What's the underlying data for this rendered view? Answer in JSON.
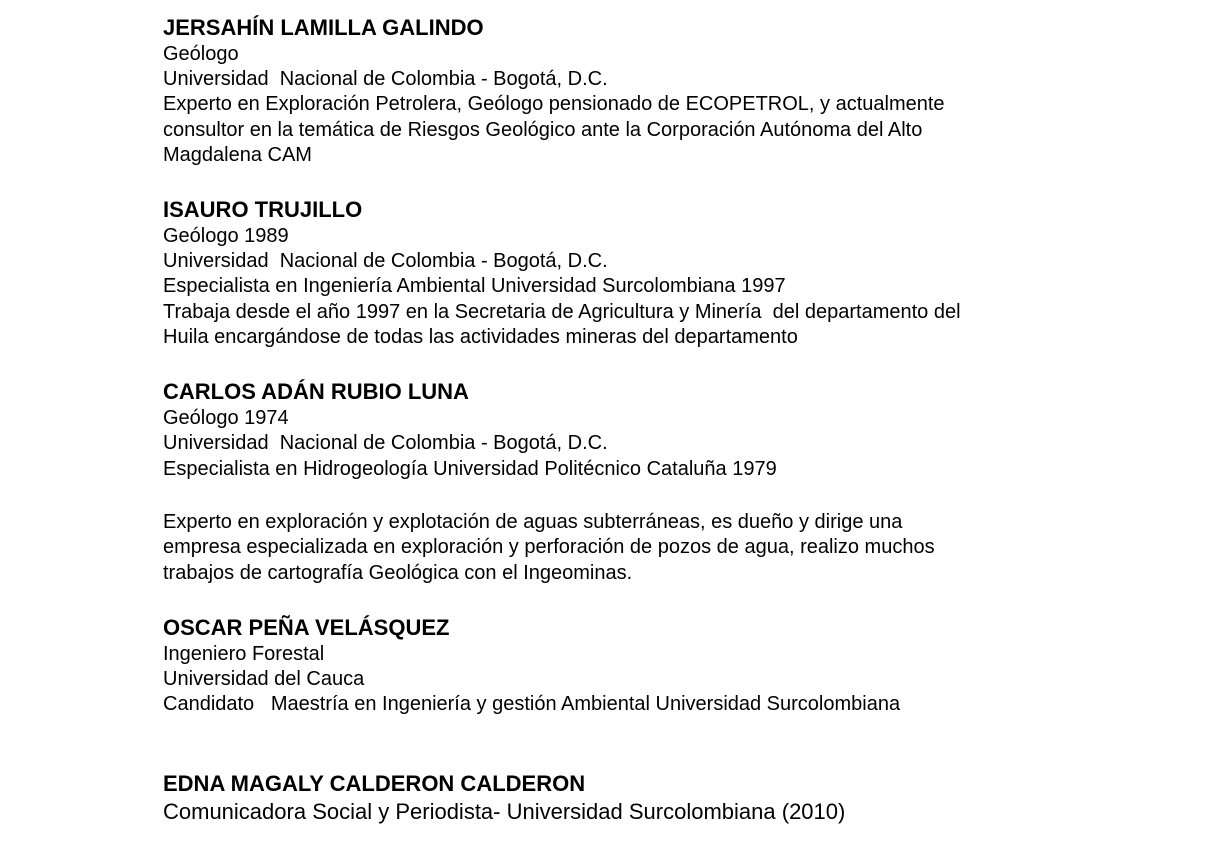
{
  "people": [
    {
      "name": "JERSAHÍN LAMILLA GALINDO",
      "lines": [
        "Geólogo",
        "Universidad  Nacional de Colombia - Bogotá, D.C.",
        "Experto en Exploración Petrolera, Geólogo pensionado de ECOPETROL, y actualmente",
        "consultor en la temática de Riesgos Geológico ante la Corporación Autónoma del Alto",
        "Magdalena CAM"
      ]
    },
    {
      "name": "ISAURO TRUJILLO",
      "lines": [
        "Geólogo 1989",
        "Universidad  Nacional de Colombia - Bogotá, D.C.",
        "Especialista en Ingeniería Ambiental Universidad Surcolombiana 1997",
        "Trabaja desde el año 1997 en la Secretaria de Agricultura y Minería  del departamento del",
        "Huila encargándose de todas las actividades mineras del departamento"
      ]
    },
    {
      "name": "CARLOS ADÁN RUBIO LUNA",
      "lines": [
        "Geólogo 1974",
        "Universidad  Nacional de Colombia - Bogotá, D.C.",
        "Especialista en Hidrogeología Universidad Politécnico Cataluña 1979",
        "Experto en exploración y explotación de aguas subterráneas, es dueño y dirige una",
        "empresa especializada en exploración y perforación de pozos de agua, realizo muchos",
        "trabajos de cartografía Geológica con el Ingeominas."
      ]
    },
    {
      "name": "OSCAR PEÑA VELÁSQUEZ",
      "lines": [
        "Ingeniero Forestal",
        "Universidad del Cauca",
        "Candidato   Maestría en Ingeniería y gestión Ambiental Universidad Surcolombiana"
      ]
    },
    {
      "name": "EDNA MAGALY CALDERON CALDERON",
      "lines": [
        "Comunicadora Social y Periodista- Universidad Surcolombiana (2010)"
      ]
    }
  ]
}
